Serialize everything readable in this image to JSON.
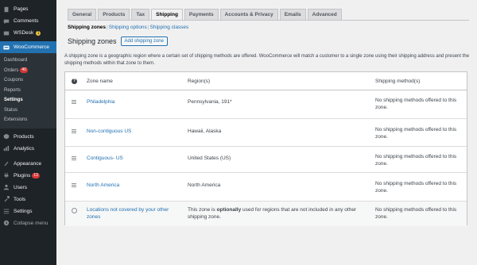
{
  "sidebar": {
    "items_top": [
      {
        "label": "Pages",
        "icon": "pages-icon"
      },
      {
        "label": "Comments",
        "icon": "comments-icon"
      },
      {
        "label": "WSDesk",
        "icon": "wsdesk-icon",
        "dot": "1"
      }
    ],
    "active": {
      "label": "WooCommerce",
      "icon": "woo-icon"
    },
    "submenu": [
      {
        "label": "Dashboard"
      },
      {
        "label": "Orders",
        "badge": "40"
      },
      {
        "label": "Coupons"
      },
      {
        "label": "Reports"
      },
      {
        "label": "Settings",
        "current": true
      },
      {
        "label": "Status"
      },
      {
        "label": "Extensions"
      }
    ],
    "items_bottom": [
      {
        "label": "Products",
        "icon": "products-icon"
      },
      {
        "label": "Analytics",
        "icon": "analytics-icon"
      },
      {
        "label": "Appearance",
        "icon": "appearance-icon"
      },
      {
        "label": "Plugins",
        "icon": "plugins-icon",
        "badge": "13"
      },
      {
        "label": "Users",
        "icon": "users-icon"
      },
      {
        "label": "Tools",
        "icon": "tools-icon"
      },
      {
        "label": "Settings",
        "icon": "settings-icon"
      },
      {
        "label": "Collapse menu",
        "icon": "collapse-icon"
      }
    ]
  },
  "tabs": [
    "General",
    "Products",
    "Tax",
    "Shipping",
    "Payments",
    "Accounts & Privacy",
    "Emails",
    "Advanced"
  ],
  "active_tab": "Shipping",
  "subnav": {
    "current": "Shipping zones",
    "links": [
      "Shipping options",
      "Shipping classes"
    ]
  },
  "page_title": "Shipping zones",
  "add_button": "Add shipping zone",
  "description": "A shipping zone is a geographic region where a certain set of shipping methods are offered. WooCommerce will match a customer to a single zone using their shipping address and present the shipping methods within that zone to them.",
  "table": {
    "headers": {
      "name": "Zone name",
      "region": "Region(s)",
      "methods": "Shipping method(s)"
    },
    "rows": [
      {
        "name": "Philadelphia",
        "region": "Pennsylvania, 191*",
        "methods": "No shipping methods offered to this zone."
      },
      {
        "name": "Non-contiguous US",
        "region": "Hawaii, Alaska",
        "methods": "No shipping methods offered to this zone."
      },
      {
        "name": "Contiguous- US",
        "region": "United States (US)",
        "methods": "No shipping methods offered to this zone."
      },
      {
        "name": "North America",
        "region": "North America",
        "methods": "No shipping methods offered to this zone."
      }
    ],
    "fallback": {
      "name": "Locations not covered by your other zones",
      "region_pre": "This zone is ",
      "region_strong": "optionally",
      "region_post": " used for regions that are not included in any other shipping zone.",
      "methods": "No shipping methods offered to this zone."
    }
  },
  "colors": {
    "sidebar_bg": "#1d2327",
    "accent": "#2271b1",
    "badge": "#d63638",
    "page_bg": "#f0f0f1"
  }
}
